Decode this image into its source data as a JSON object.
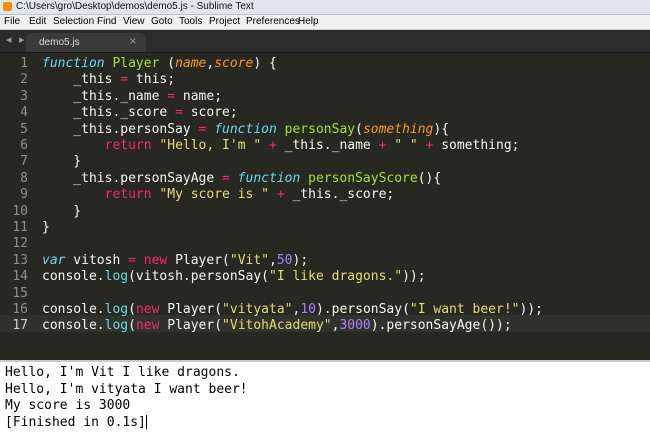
{
  "window": {
    "title": "C:\\Users\\gro\\Desktop\\demos\\demo5.js - Sublime Text"
  },
  "menu": [
    "File",
    "Edit",
    "Selection",
    "Find",
    "View",
    "Goto",
    "Tools",
    "Project",
    "Preferences",
    "Help"
  ],
  "tab": {
    "nav": "◂ ▸",
    "label": "demo5.js",
    "close": "×"
  },
  "colors": {
    "background": "#272822",
    "keyword": "#66d9ef",
    "function_name": "#a6e22e",
    "parameter": "#fd971f",
    "operator": "#f92672",
    "string": "#e6db74",
    "number": "#ae81ff"
  },
  "editor": {
    "line_numbers": [
      "1",
      "2",
      "3",
      "4",
      "5",
      "6",
      "7",
      "8",
      "9",
      "10",
      "11",
      "12",
      "13",
      "14",
      "15",
      "16",
      "17"
    ],
    "active_line": "17",
    "lines": [
      [
        {
          "t": "function",
          "c": "kw"
        },
        {
          "t": " "
        },
        {
          "t": "Player",
          "c": "nm"
        },
        {
          "t": " ("
        },
        {
          "t": "name",
          "c": "pm"
        },
        {
          "t": ","
        },
        {
          "t": "score",
          "c": "pm"
        },
        {
          "t": ") {"
        }
      ],
      [
        {
          "t": "    _this "
        },
        {
          "t": "=",
          "c": "op"
        },
        {
          "t": " this;"
        }
      ],
      [
        {
          "t": "    _this._name "
        },
        {
          "t": "=",
          "c": "op"
        },
        {
          "t": " name;"
        }
      ],
      [
        {
          "t": "    _this._score "
        },
        {
          "t": "=",
          "c": "op"
        },
        {
          "t": " score;"
        }
      ],
      [
        {
          "t": "    _this.personSay "
        },
        {
          "t": "=",
          "c": "op"
        },
        {
          "t": " "
        },
        {
          "t": "function",
          "c": "kw"
        },
        {
          "t": " "
        },
        {
          "t": "personSay",
          "c": "nm"
        },
        {
          "t": "("
        },
        {
          "t": "something",
          "c": "pm"
        },
        {
          "t": "){"
        }
      ],
      [
        {
          "t": "        "
        },
        {
          "t": "return",
          "c": "op"
        },
        {
          "t": " "
        },
        {
          "t": "\"Hello, I'm \"",
          "c": "st"
        },
        {
          "t": " "
        },
        {
          "t": "+",
          "c": "op"
        },
        {
          "t": " _this._name "
        },
        {
          "t": "+",
          "c": "op"
        },
        {
          "t": " "
        },
        {
          "t": "\" \"",
          "c": "st"
        },
        {
          "t": " "
        },
        {
          "t": "+",
          "c": "op"
        },
        {
          "t": " something;"
        }
      ],
      [
        {
          "t": "    }"
        }
      ],
      [
        {
          "t": "    _this.personSayAge "
        },
        {
          "t": "=",
          "c": "op"
        },
        {
          "t": " "
        },
        {
          "t": "function",
          "c": "kw"
        },
        {
          "t": " "
        },
        {
          "t": "personSayScore",
          "c": "nm"
        },
        {
          "t": "(){"
        }
      ],
      [
        {
          "t": "        "
        },
        {
          "t": "return",
          "c": "op"
        },
        {
          "t": " "
        },
        {
          "t": "\"My score is \"",
          "c": "st"
        },
        {
          "t": " "
        },
        {
          "t": "+",
          "c": "op"
        },
        {
          "t": " _this._score;"
        }
      ],
      [
        {
          "t": "    }"
        }
      ],
      [
        {
          "t": "}"
        }
      ],
      [],
      [
        {
          "t": "var",
          "c": "kw"
        },
        {
          "t": " vitosh "
        },
        {
          "t": "=",
          "c": "op"
        },
        {
          "t": " "
        },
        {
          "t": "new",
          "c": "op"
        },
        {
          "t": " Player("
        },
        {
          "t": "\"Vit\"",
          "c": "st"
        },
        {
          "t": ","
        },
        {
          "t": "50",
          "c": "num"
        },
        {
          "t": ");"
        }
      ],
      [
        {
          "t": "console."
        },
        {
          "t": "log",
          "c": "sup"
        },
        {
          "t": "(vitosh.personSay("
        },
        {
          "t": "\"I like dragons.\"",
          "c": "st"
        },
        {
          "t": "));"
        }
      ],
      [],
      [
        {
          "t": "console."
        },
        {
          "t": "log",
          "c": "sup"
        },
        {
          "t": "("
        },
        {
          "t": "new",
          "c": "op"
        },
        {
          "t": " Player("
        },
        {
          "t": "\"vityata\"",
          "c": "st"
        },
        {
          "t": ","
        },
        {
          "t": "10",
          "c": "num"
        },
        {
          "t": ").personSay("
        },
        {
          "t": "\"I want beer!\"",
          "c": "st"
        },
        {
          "t": "));"
        }
      ],
      [
        {
          "t": "console."
        },
        {
          "t": "log",
          "c": "sup"
        },
        {
          "t": "("
        },
        {
          "t": "new",
          "c": "op"
        },
        {
          "t": " Player("
        },
        {
          "t": "\"VitohAcademy\"",
          "c": "st"
        },
        {
          "t": ","
        },
        {
          "t": "3000",
          "c": "num"
        },
        {
          "t": ").personSayAge());"
        }
      ]
    ]
  },
  "console": {
    "lines": [
      "Hello, I'm Vit I like dragons.",
      "Hello, I'm vityata I want beer!",
      "My score is 3000",
      "[Finished in 0.1s]"
    ]
  }
}
